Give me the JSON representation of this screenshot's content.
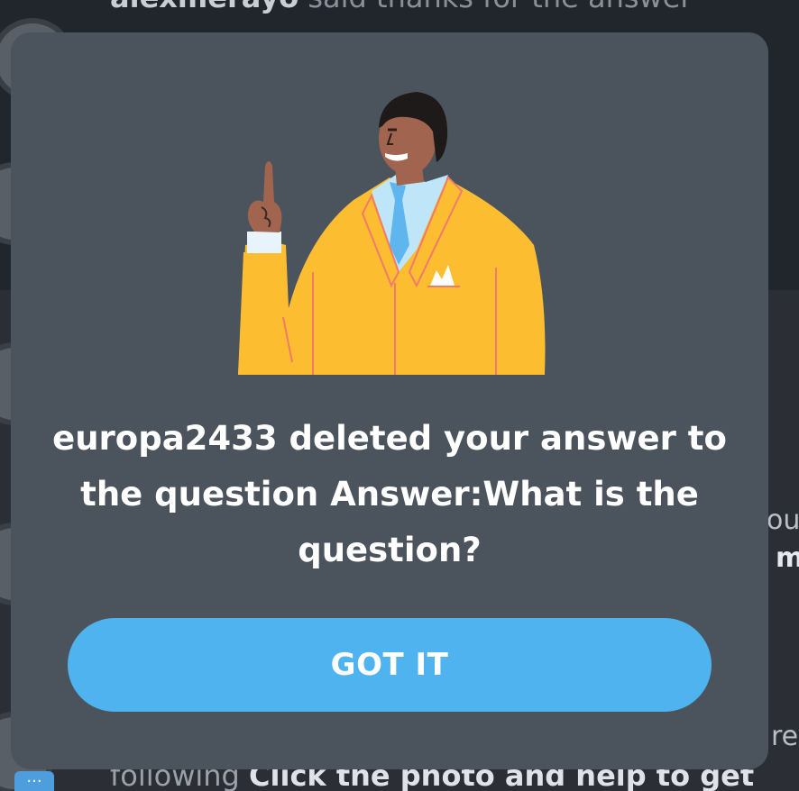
{
  "background": {
    "top_notification": {
      "username": "alexmerayo",
      "text": " said thanks for the answer"
    },
    "bottom_notification": {
      "prefix": "following ",
      "bold": "Click the photo and help to get"
    },
    "right_fragments": [
      "ou",
      "m",
      "re"
    ]
  },
  "modal": {
    "message": "europa2433 deleted your answer to the question Answer:What is the question?",
    "button_label": "GOT IT",
    "illustration": "man-pointing-up-illustration"
  },
  "colors": {
    "modal_bg": "#4b535c",
    "button_bg": "#4fb3f0",
    "suit": "#fdbd31",
    "tie": "#5fb6ee"
  }
}
